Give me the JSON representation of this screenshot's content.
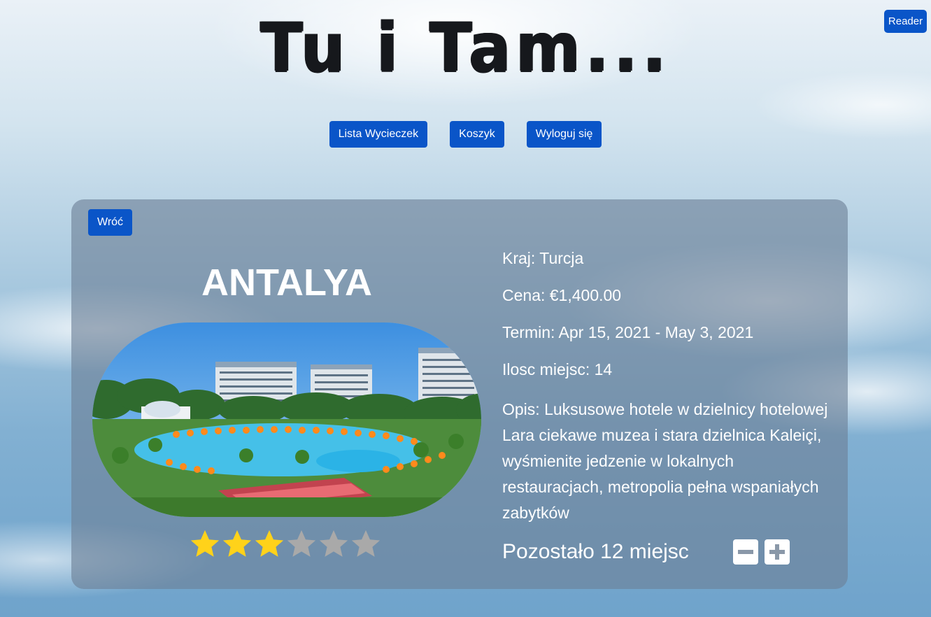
{
  "toolbar": {
    "reader_label": "Reader"
  },
  "header": {
    "title": "Tu i Tam..."
  },
  "nav": {
    "items": [
      {
        "label": "Lista Wycieczek"
      },
      {
        "label": "Koszyk"
      },
      {
        "label": "Wyloguj się"
      }
    ]
  },
  "trip": {
    "back_label": "Wróć",
    "name": "ANTALYA",
    "image_alt": "hotel resort with pools",
    "rating": {
      "value": 3,
      "max": 6
    },
    "country_line": "Kraj: Turcja",
    "price_line": "Cena: €1,400.00",
    "term_line": "Termin: Apr 15, 2021 - May 3, 2021",
    "seats_line": "Ilosc miejsc: 14",
    "description_line": "Opis: Luksusowe hotele w dzielnicy hotelowej Lara ciekawe muzea i stara dzielnica Kaleiçi, wyśmienite jedzenie w lokalnych restauracjach, metropolia pełna wspaniałych zabytków",
    "remaining_line": "Pozostało 12 miejsc",
    "decrease_icon": "minus-square-icon",
    "increase_icon": "plus-square-icon"
  },
  "colors": {
    "primary_button": "#0a55c8",
    "star_filled": "#ffd21a",
    "star_empty": "#a9a9a9",
    "card_bg": "rgba(108,128,150,0.62)"
  }
}
